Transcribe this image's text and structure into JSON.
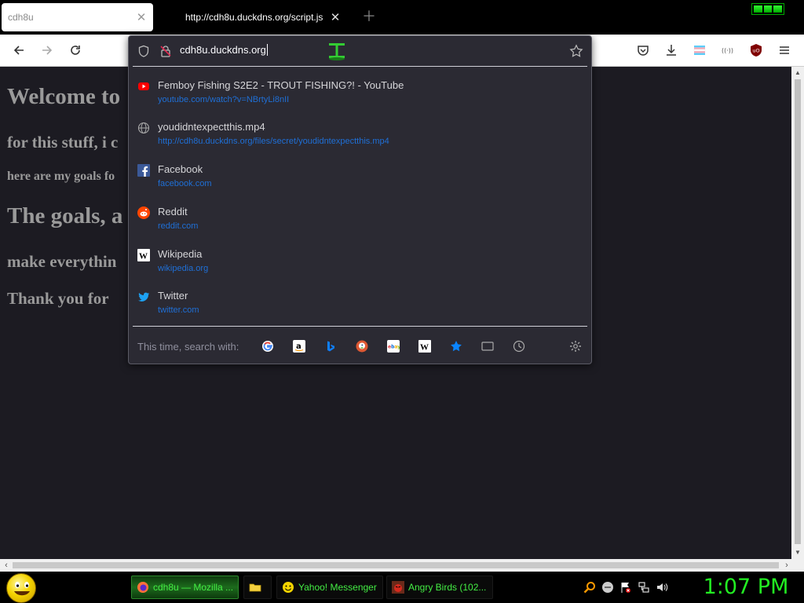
{
  "tabs": [
    {
      "title": "cdh8u",
      "active": true
    },
    {
      "title": "http://cdh8u.duckdns.org/script.js",
      "active": false
    }
  ],
  "urlbar": {
    "value": "cdh8u.duckdns.org"
  },
  "page": {
    "lines": [
      "Welcome to",
      "for this stuff, i c",
      "here are my goals fo",
      "The goals, a",
      "make everythin",
      "Thank you for"
    ]
  },
  "results": [
    {
      "title": "Femboy Fishing S2E2 - TROUT FISHING?! - YouTube",
      "url": "youtube.com/watch?v=NBrtyLi8nII",
      "icon": "youtube-icon"
    },
    {
      "title": "youdidntexpectthis.mp4",
      "url": "http://cdh8u.duckdns.org/files/secret/youdidntexpectthis.mp4",
      "icon": "globe-icon"
    },
    {
      "title": "Facebook",
      "url": "facebook.com",
      "icon": "facebook-icon"
    },
    {
      "title": "Reddit",
      "url": "reddit.com",
      "icon": "reddit-icon"
    },
    {
      "title": "Wikipedia",
      "url": "wikipedia.org",
      "icon": "wikipedia-icon"
    },
    {
      "title": "Twitter",
      "url": "twitter.com",
      "icon": "twitter-icon"
    }
  ],
  "search_with": {
    "label": "This time, search with:",
    "engines": [
      "google-icon",
      "amazon-icon",
      "bing-icon",
      "duckduckgo-icon",
      "ebay-icon",
      "wikipedia-icon",
      "bookmarks-icon",
      "tabs-icon",
      "history-icon",
      "settings-icon"
    ]
  },
  "taskbar": {
    "tasks": [
      {
        "label": "cdh8u — Mozilla ...",
        "icon": "firefox-icon"
      },
      {
        "label": "",
        "icon": "folder-icon"
      },
      {
        "label": "Yahoo! Messenger",
        "icon": "yahoo-messenger-icon"
      },
      {
        "label": "Angry Birds (102...",
        "icon": "angry-birds-icon"
      }
    ],
    "clock": "1:07 PM"
  },
  "colors": {
    "page_bg": "#1c1b22",
    "panel_bg": "#2b2a33",
    "result_url": "#1f6fd6",
    "taskbar_text": "#44ee44",
    "clock": "#22ee22"
  }
}
